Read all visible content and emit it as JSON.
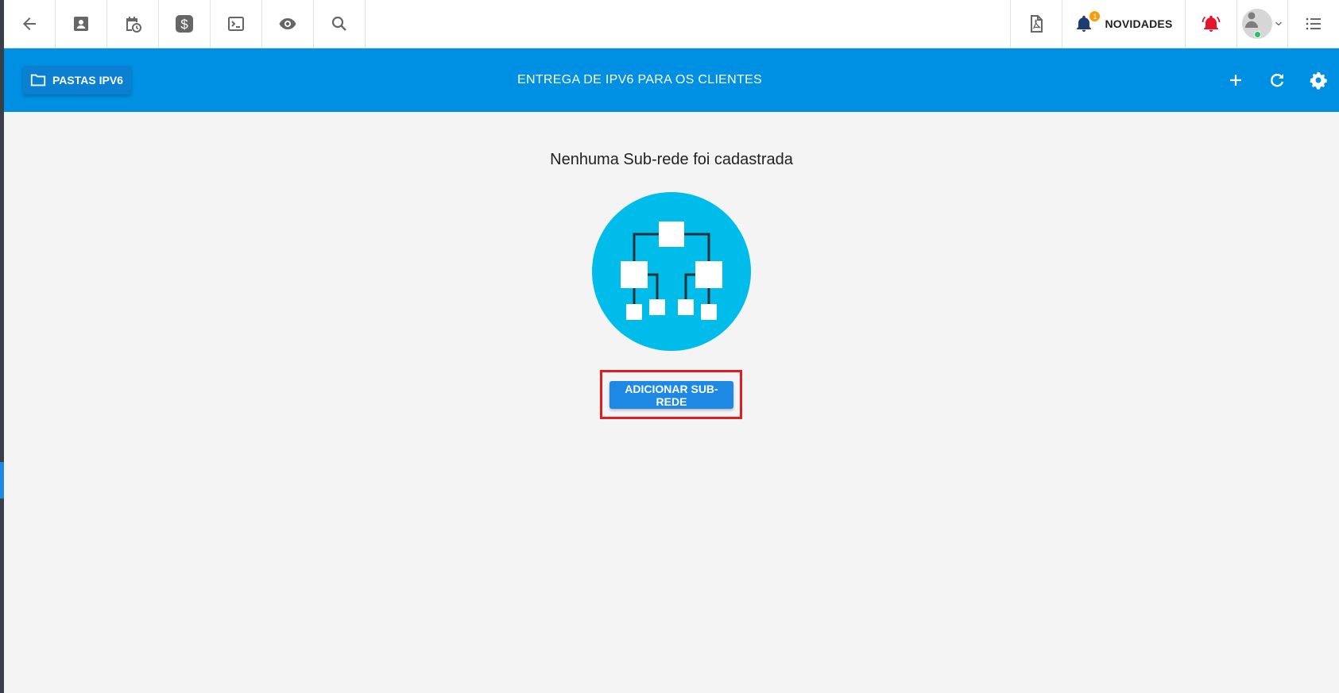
{
  "topbar": {
    "left_icons": [
      "arrow-left-icon",
      "contact-card-icon",
      "calendar-clock-icon",
      "dollar-icon",
      "terminal-icon",
      "eye-icon",
      "search-icon"
    ],
    "right": {
      "pdf_icon": "pdf-file-icon",
      "news": {
        "badge": "1",
        "label": "NOVIDADES"
      },
      "alarm_icon": "alarm-bell-icon",
      "menu_icon": "list-icon"
    }
  },
  "header": {
    "folder_button_label": "PASTAS IPV6",
    "title": "ENTREGA DE IPV6 PARA OS CLIENTES",
    "actions": [
      "plus-icon",
      "refresh-icon",
      "gear-icon"
    ]
  },
  "main": {
    "empty_message": "Nenhuma Sub-rede foi cadastrada",
    "add_button_label": "ADICIONAR SUB-REDE"
  },
  "colors": {
    "brand_blue": "#0090e3",
    "button_blue": "#1e88e5",
    "illustration_circle": "#00bcea",
    "highlight_red": "#e11d1d",
    "alarm_red": "#e5142a",
    "bell_navy": "#1f3c6e"
  }
}
